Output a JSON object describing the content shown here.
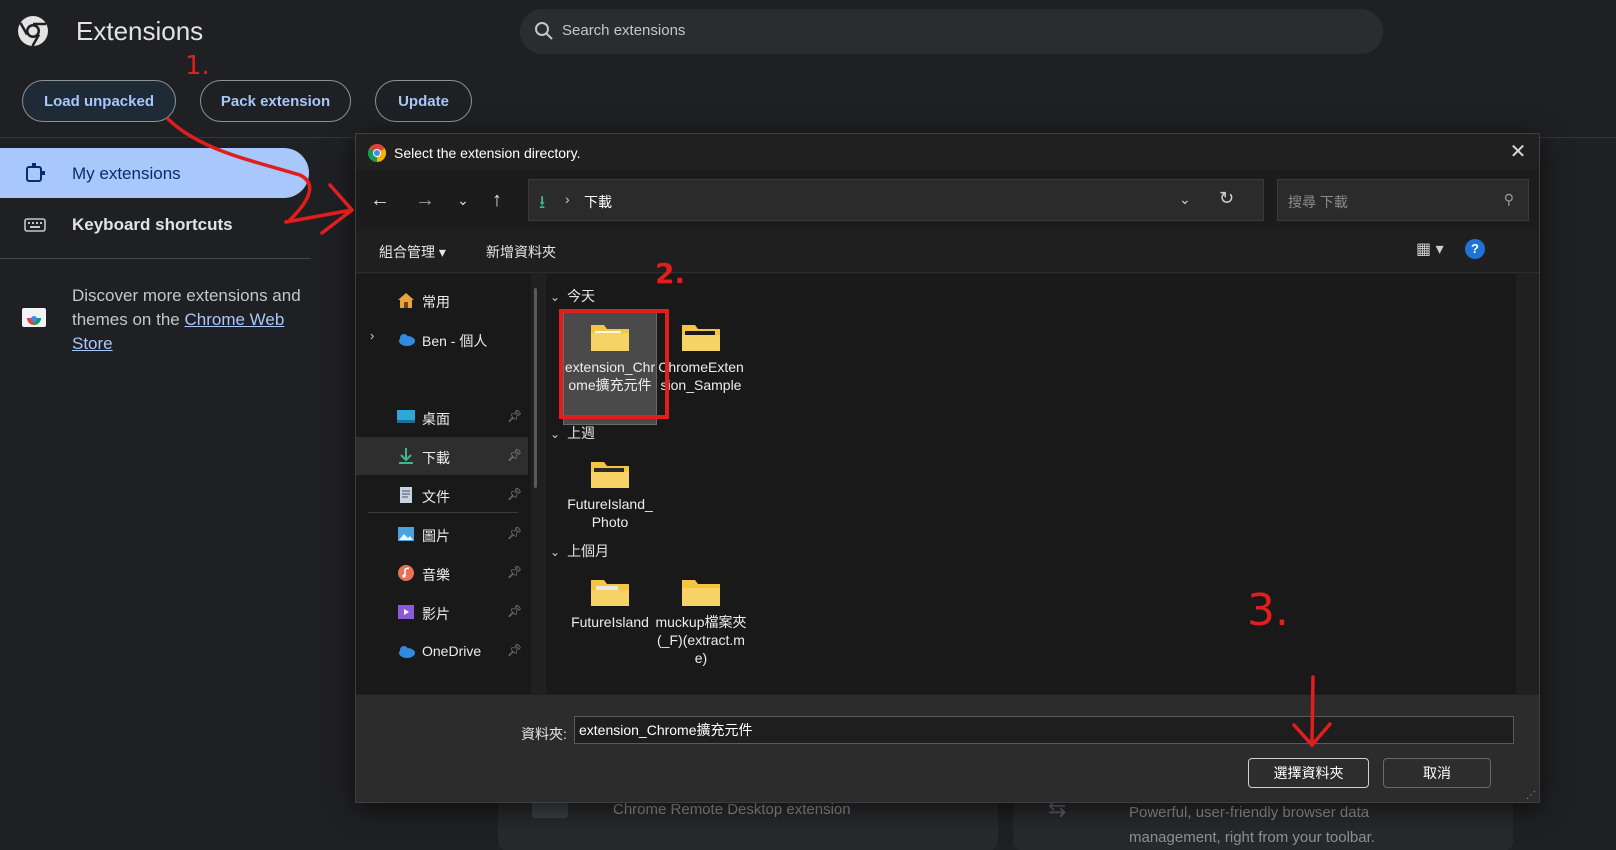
{
  "page": {
    "title": "Extensions",
    "search_placeholder": "Search extensions",
    "actions": {
      "load_unpacked": "Load unpacked",
      "pack_extension": "Pack extension",
      "update": "Update"
    },
    "nav": {
      "my_extensions": "My extensions",
      "keyboard_shortcuts": "Keyboard shortcuts"
    },
    "store_promo": {
      "text": "Discover more extensions and themes on the ",
      "link": "Chrome Web Store"
    },
    "cards": {
      "left_desc": "Chrome Remote Desktop extension",
      "right_desc": "Powerful, user-friendly browser data management, right from your toolbar."
    }
  },
  "dialog": {
    "title": "Select the extension directory.",
    "address": {
      "location": "下載"
    },
    "search_placeholder": "搜尋 下載",
    "toolbar": {
      "organize": "組合管理 ▾",
      "new_folder": "新增資料夾",
      "help": "?"
    },
    "nav_pane": [
      {
        "label": "常用",
        "icon": "home-icon",
        "pinned": false
      },
      {
        "label": "Ben - 個人",
        "icon": "cloud-icon",
        "pinned": false
      },
      {
        "label": "桌面",
        "icon": "desktop-icon",
        "pinned": true
      },
      {
        "label": "下載",
        "icon": "download-icon",
        "pinned": true,
        "selected": true
      },
      {
        "label": "文件",
        "icon": "document-icon",
        "pinned": true
      },
      {
        "label": "圖片",
        "icon": "pictures-icon",
        "pinned": true
      },
      {
        "label": "音樂",
        "icon": "music-icon",
        "pinned": true
      },
      {
        "label": "影片",
        "icon": "video-icon",
        "pinned": true
      },
      {
        "label": "OneDrive",
        "icon": "onedrive-icon",
        "pinned": true
      }
    ],
    "groups": [
      {
        "label": "今天",
        "items": [
          "extension_Chrome擴充元件",
          "ChromeExtension_Sample"
        ]
      },
      {
        "label": "上週",
        "items": [
          "FutureIsland_Photo"
        ]
      },
      {
        "label": "上個月",
        "items": [
          "FutureIsland",
          "muckup檔案夾(_F)(extract.me)"
        ]
      }
    ],
    "selected_item": "extension_Chrome擴充元件",
    "folder_label": "資料夾:",
    "folder_value": "extension_Chrome擴充元件",
    "buttons": {
      "select": "選擇資料夾",
      "cancel": "取消"
    }
  },
  "annotations": {
    "step1": "1.",
    "step2": "2.",
    "step3": "3."
  },
  "colors": {
    "accent": "#a8c7fa",
    "annotation": "#e01e1e",
    "folder": "#f4c542"
  }
}
